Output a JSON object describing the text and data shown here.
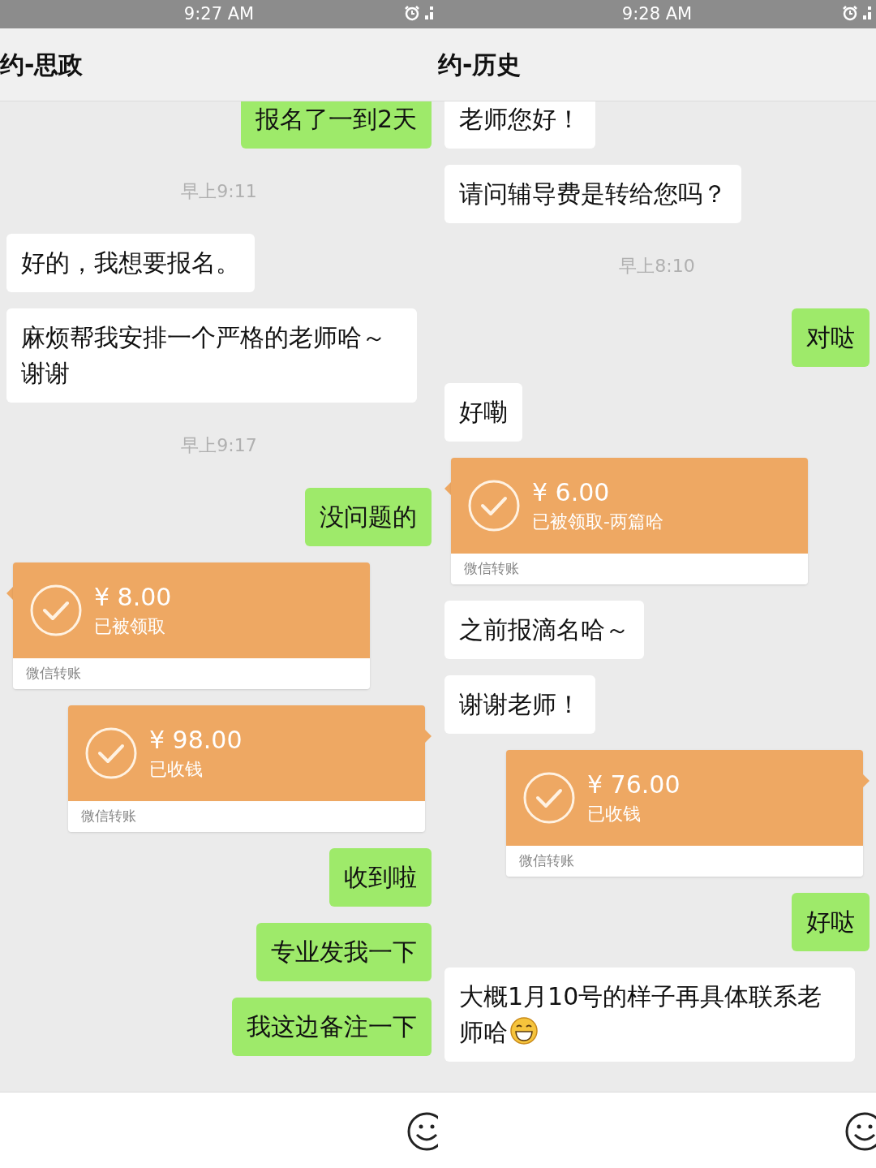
{
  "panels": [
    {
      "status_bar": {
        "time": "9:27 AM"
      },
      "title": "约-思政",
      "messages": [
        {
          "kind": "text",
          "outgoing": true,
          "text": "报名了一到2天"
        },
        {
          "kind": "time",
          "text": "早上9:11"
        },
        {
          "kind": "text",
          "outgoing": false,
          "text": "好的，我想要报名。"
        },
        {
          "kind": "text",
          "outgoing": false,
          "text": "麻烦帮我安排一个严格的老师哈～谢谢"
        },
        {
          "kind": "time",
          "text": "早上9:17"
        },
        {
          "kind": "text",
          "outgoing": true,
          "text": "没问题的"
        },
        {
          "kind": "transfer",
          "outgoing": false,
          "currency": "¥",
          "amount": "8.00",
          "status": "已被领取",
          "label": "微信转账"
        },
        {
          "kind": "transfer",
          "outgoing": true,
          "currency": "¥",
          "amount": "98.00",
          "status": "已收钱",
          "label": "微信转账"
        },
        {
          "kind": "text",
          "outgoing": true,
          "text": "收到啦"
        },
        {
          "kind": "text",
          "outgoing": true,
          "text": "专业发我一下"
        },
        {
          "kind": "text",
          "outgoing": true,
          "text": "我这边备注一下"
        }
      ]
    },
    {
      "status_bar": {
        "time": "9:28 AM"
      },
      "title": "约-历史",
      "messages": [
        {
          "kind": "text",
          "outgoing": false,
          "text": "老师您好！"
        },
        {
          "kind": "text",
          "outgoing": false,
          "text": "请问辅导费是转给您吗？"
        },
        {
          "kind": "time",
          "text": "早上8:10"
        },
        {
          "kind": "text",
          "outgoing": true,
          "text": "对哒"
        },
        {
          "kind": "text",
          "outgoing": false,
          "text": "好嘞"
        },
        {
          "kind": "transfer",
          "outgoing": false,
          "currency": "¥",
          "amount": "6.00",
          "status": "已被领取-两篇哈",
          "label": "微信转账"
        },
        {
          "kind": "text",
          "outgoing": false,
          "text": "之前报滴名哈～"
        },
        {
          "kind": "text",
          "outgoing": false,
          "text": "谢谢老师！"
        },
        {
          "kind": "transfer",
          "outgoing": true,
          "currency": "¥",
          "amount": "76.00",
          "status": "已收钱",
          "label": "微信转账"
        },
        {
          "kind": "text",
          "outgoing": true,
          "text": "好哒"
        },
        {
          "kind": "text",
          "outgoing": false,
          "text": "大概1月10号的样子再具体联系老师哈",
          "emoji": true
        }
      ]
    }
  ]
}
